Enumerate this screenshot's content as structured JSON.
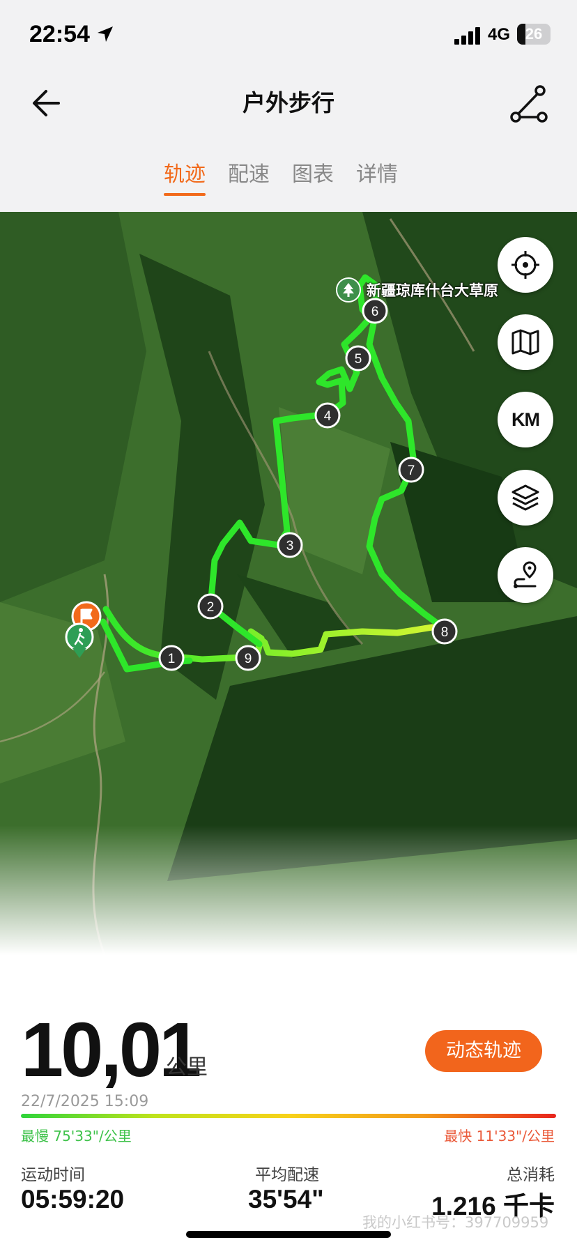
{
  "status_bar": {
    "time": "22:54",
    "network": "4G",
    "battery": "26"
  },
  "nav": {
    "title": "户外步行",
    "back_icon": "arrow-left-icon",
    "share_icon": "route-share-icon"
  },
  "tabs": [
    {
      "label": "轨迹",
      "active": true
    },
    {
      "label": "配速",
      "active": false
    },
    {
      "label": "图表",
      "active": false
    },
    {
      "label": "详情",
      "active": false
    }
  ],
  "map": {
    "poi_label": "新疆琼库什台大草原",
    "markers": [
      "1",
      "2",
      "3",
      "4",
      "5",
      "6",
      "7",
      "8",
      "9"
    ],
    "buttons": [
      {
        "name": "locate-button",
        "icon": "crosshair-icon"
      },
      {
        "name": "map-style-button",
        "icon": "map-icon"
      },
      {
        "name": "km-markers-button",
        "label": "KM"
      },
      {
        "name": "layers-button",
        "icon": "layers-icon"
      },
      {
        "name": "route-pin-button",
        "icon": "route-pin-icon"
      }
    ],
    "colors": {
      "route_slow": "#2ee62a",
      "route_fast": "#d6f533",
      "start": "#2e9e55",
      "end": "#f26a1b"
    }
  },
  "summary": {
    "distance": "10,01",
    "distance_unit": "公里",
    "dynamic_track_button": "动态轨迹",
    "date": "22/7/2025 15:09",
    "slowest": "最慢 75'33\"/公里",
    "fastest": "最快 11'33\"/公里",
    "stats": [
      {
        "label": "运动时间",
        "value": "05:59:20"
      },
      {
        "label": "平均配速",
        "value": "35'54\""
      },
      {
        "label": "总消耗",
        "value": "1.216 千卡"
      }
    ],
    "watermark": "我的小红书号：397709959"
  }
}
